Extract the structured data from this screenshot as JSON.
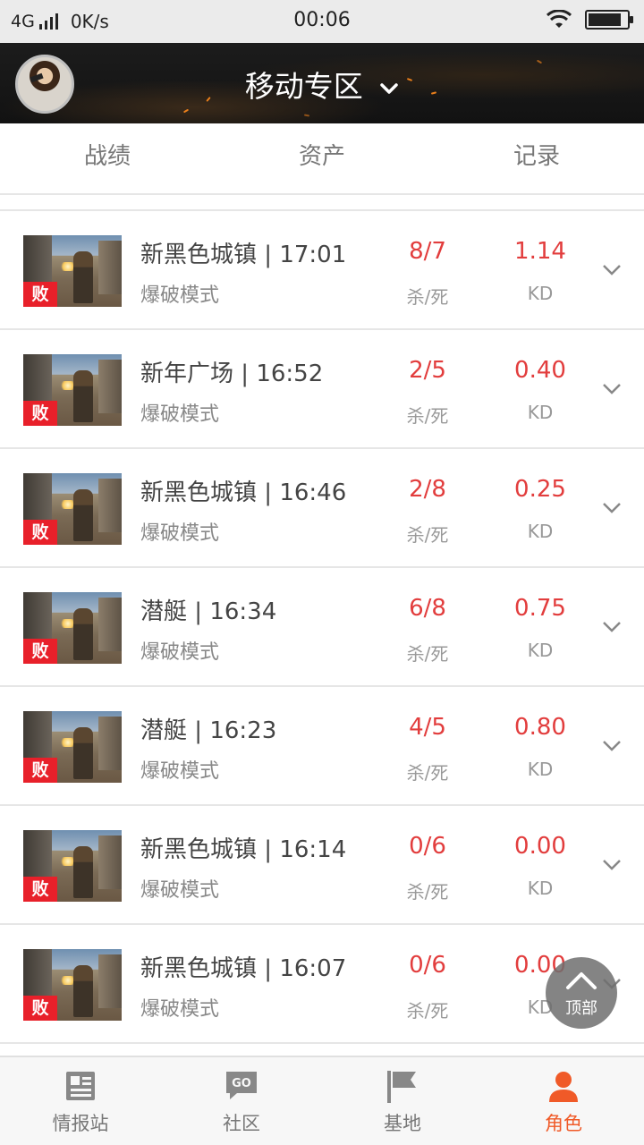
{
  "status_bar": {
    "network": "4G",
    "speed": "0K/s",
    "time": "00:06",
    "battery_level": 0.85
  },
  "header": {
    "title": "移动专区",
    "avatar_icon": "player-avatar"
  },
  "tabs": [
    {
      "label": "战绩",
      "active": true
    },
    {
      "label": "资产",
      "active": false
    },
    {
      "label": "记录",
      "active": false
    }
  ],
  "matches": [
    {
      "result": "败",
      "map": "新黑色城镇",
      "time": "17:01",
      "mode": "爆破模式",
      "kill_death": "8/7",
      "kill_death_label": "杀/死",
      "kd": "1.14",
      "kd_label": "KD"
    },
    {
      "result": "败",
      "map": "新年广场",
      "time": "16:52",
      "mode": "爆破模式",
      "kill_death": "2/5",
      "kill_death_label": "杀/死",
      "kd": "0.40",
      "kd_label": "KD"
    },
    {
      "result": "败",
      "map": "新黑色城镇",
      "time": "16:46",
      "mode": "爆破模式",
      "kill_death": "2/8",
      "kill_death_label": "杀/死",
      "kd": "0.25",
      "kd_label": "KD"
    },
    {
      "result": "败",
      "map": "潜艇",
      "time": "16:34",
      "mode": "爆破模式",
      "kill_death": "6/8",
      "kill_death_label": "杀/死",
      "kd": "0.75",
      "kd_label": "KD"
    },
    {
      "result": "败",
      "map": "潜艇",
      "time": "16:23",
      "mode": "爆破模式",
      "kill_death": "4/5",
      "kill_death_label": "杀/死",
      "kd": "0.80",
      "kd_label": "KD"
    },
    {
      "result": "败",
      "map": "新黑色城镇",
      "time": "16:14",
      "mode": "爆破模式",
      "kill_death": "0/6",
      "kill_death_label": "杀/死",
      "kd": "0.00",
      "kd_label": "KD"
    },
    {
      "result": "败",
      "map": "新黑色城镇",
      "time": "16:07",
      "mode": "爆破模式",
      "kill_death": "0/6",
      "kill_death_label": "杀/死",
      "kd": "0.00",
      "kd_label": "KD"
    }
  ],
  "back_to_top": {
    "label": "顶部",
    "icon": "chevron-up-icon"
  },
  "bottom_nav": [
    {
      "label": "情报站",
      "icon": "news-icon",
      "active": false
    },
    {
      "label": "社区",
      "icon": "community-icon",
      "active": false
    },
    {
      "label": "基地",
      "icon": "flag-icon",
      "active": false
    },
    {
      "label": "角色",
      "icon": "user-icon",
      "active": true
    }
  ],
  "colors": {
    "accent": "#f05a28",
    "stat_red": "#e23d3d",
    "lose_badge": "#e8202a"
  }
}
